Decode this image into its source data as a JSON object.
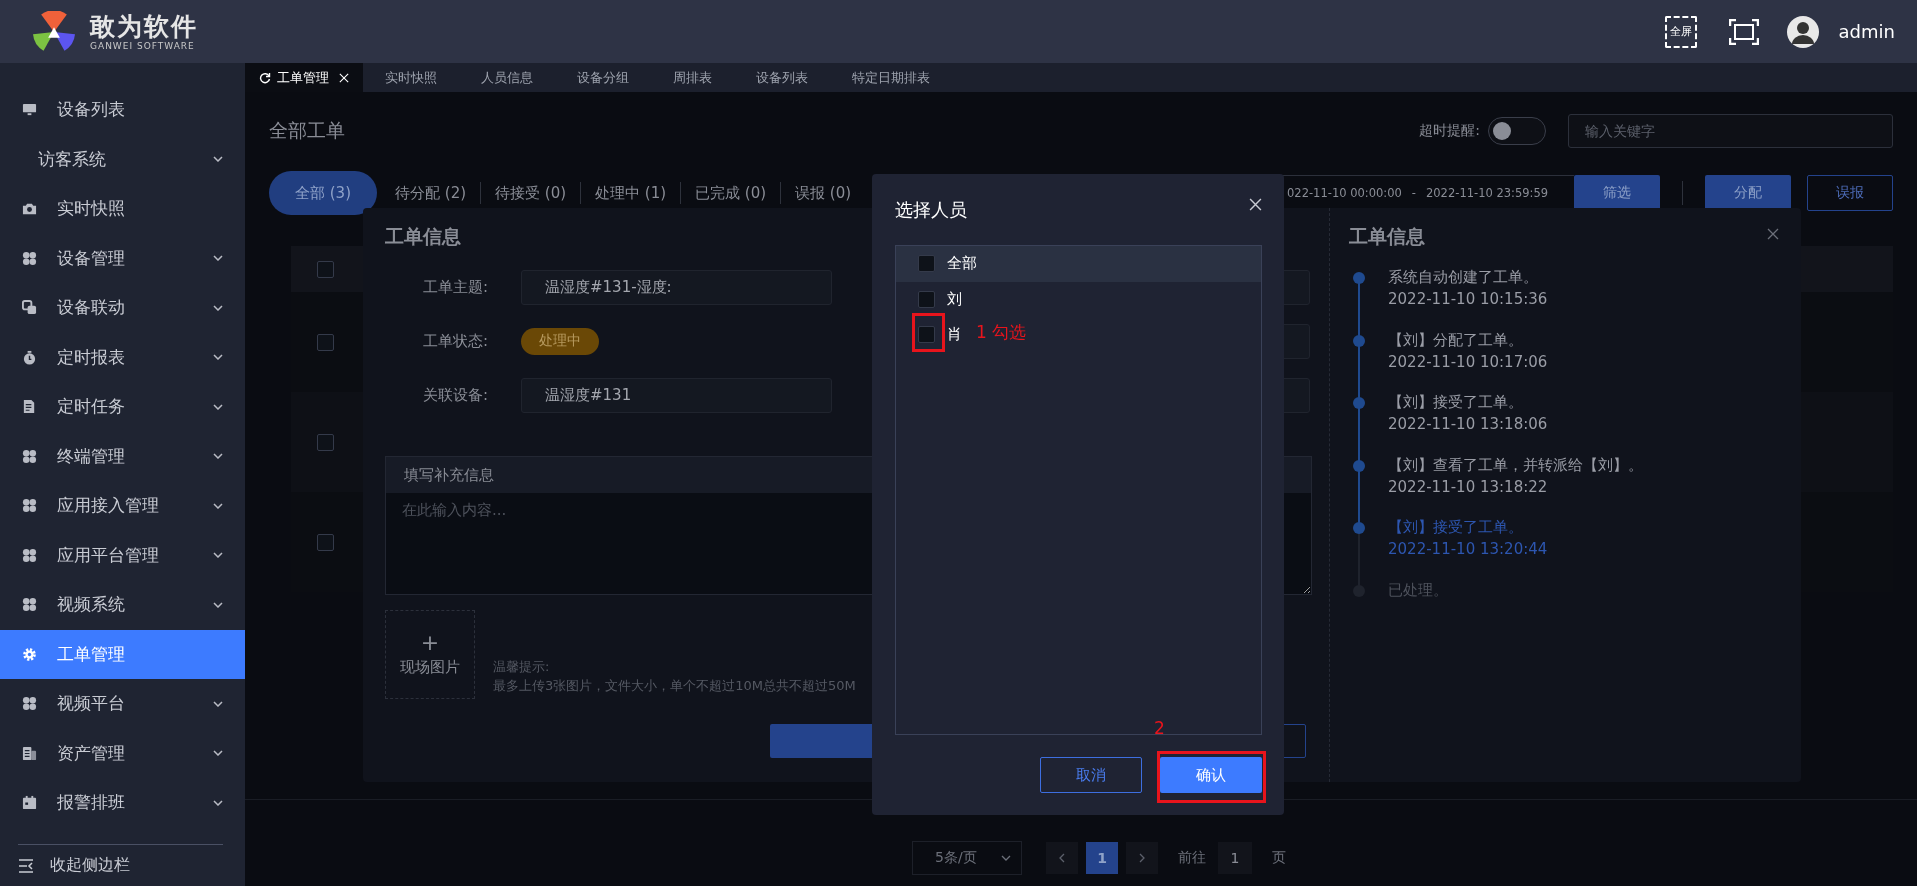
{
  "header": {
    "logo_title": "敢为软件",
    "logo_subtitle": "GANWEI SOFTWARE",
    "fullscreen_label": "全屏",
    "user": "admin"
  },
  "sidebar": {
    "items": [
      {
        "label": "设备列表",
        "kind": "monitor",
        "expandable": false,
        "selected": false
      },
      {
        "label": "访客系统",
        "kind": "plain",
        "expandable": true,
        "selected": false
      },
      {
        "label": "实时快照",
        "kind": "camera",
        "expandable": false,
        "selected": false
      },
      {
        "label": "设备管理",
        "kind": "clover",
        "expandable": true,
        "selected": false
      },
      {
        "label": "设备联动",
        "kind": "link",
        "expandable": true,
        "selected": false
      },
      {
        "label": "定时报表",
        "kind": "stopwatch",
        "expandable": true,
        "selected": false
      },
      {
        "label": "定时任务",
        "kind": "document",
        "expandable": true,
        "selected": false
      },
      {
        "label": "终端管理",
        "kind": "clover",
        "expandable": true,
        "selected": false
      },
      {
        "label": "应用接入管理",
        "kind": "clover",
        "expandable": true,
        "selected": false
      },
      {
        "label": "应用平台管理",
        "kind": "clover",
        "expandable": true,
        "selected": false
      },
      {
        "label": "视频系统",
        "kind": "clover",
        "expandable": true,
        "selected": false
      },
      {
        "label": "工单管理",
        "kind": "gear",
        "expandable": false,
        "selected": true
      },
      {
        "label": "视频平台",
        "kind": "clover",
        "expandable": true,
        "selected": false
      },
      {
        "label": "资产管理",
        "kind": "ledger",
        "expandable": true,
        "selected": false
      },
      {
        "label": "报警排班",
        "kind": "calendar",
        "expandable": true,
        "selected": false
      }
    ],
    "collapse_label": "收起侧边栏"
  },
  "tabs": [
    {
      "label": "工单管理",
      "selected": true,
      "closable": true
    },
    {
      "label": "实时快照",
      "selected": false,
      "closable": false
    },
    {
      "label": "人员信息",
      "selected": false,
      "closable": false
    },
    {
      "label": "设备分组",
      "selected": false,
      "closable": false
    },
    {
      "label": "周排表",
      "selected": false,
      "closable": false
    },
    {
      "label": "设备列表",
      "selected": false,
      "closable": false
    },
    {
      "label": "特定日期排表",
      "selected": false,
      "closable": false
    }
  ],
  "page": {
    "title": "全部工单",
    "timeout_label": "超时提醒:",
    "timeout_on": false,
    "search_placeholder": "输入关键字"
  },
  "filters": [
    {
      "label": "全部 (3)",
      "selected": true
    },
    {
      "label": "待分配 (2)",
      "selected": false
    },
    {
      "label": "待接受 (0)",
      "selected": false
    },
    {
      "label": "处理中 (1)",
      "selected": false
    },
    {
      "label": "已完成 (0)",
      "selected": false
    },
    {
      "label": "误报 (0)",
      "selected": false
    }
  ],
  "date_range": {
    "start": "022-11-10 00:00:00",
    "separator": "-",
    "end": "2022-11-10 23:59:59"
  },
  "actions": [
    {
      "label": "筛选",
      "kind": "primary"
    },
    {
      "label": "分配",
      "kind": "primary"
    },
    {
      "label": "误报",
      "kind": "outline"
    }
  ],
  "table": {
    "header_checked": false,
    "rows": [
      {
        "checked": false
      },
      {
        "checked": false
      },
      {
        "checked": false
      }
    ]
  },
  "pagination": {
    "page_size": "5条/页",
    "pages": [
      {
        "label": "1",
        "selected": true
      }
    ],
    "goto_label": "前往",
    "goto_value": "1",
    "page_label": "页"
  },
  "order_dialog": {
    "title": "工单信息",
    "fields": [
      {
        "label": "工单主题:",
        "kind": "input",
        "value": "温湿度#131-湿度:"
      },
      {
        "label": "工单状态:",
        "kind": "badge",
        "value": "处理中"
      },
      {
        "label": "关联设备:",
        "kind": "input",
        "value": "温湿度#131"
      }
    ],
    "note_title": "填写补充信息",
    "note_placeholder": "在此输入内容...",
    "upload_plus": "+",
    "upload_label": "现场图片",
    "hint_title": "温馨提示:",
    "hint": "最多上传3张图片，文件大小，单个不超过10M总共不超过50M"
  },
  "history": {
    "title": "工单信息",
    "events": [
      {
        "text": "系统自动创建了工单。",
        "time": "2022-11-10 10:15:36",
        "reached": true,
        "current": false
      },
      {
        "text": "【刘】分配了工单。",
        "time": "2022-11-10 10:17:06",
        "reached": true,
        "current": false
      },
      {
        "text": "【刘】接受了工单。",
        "time": "2022-11-10 13:18:06",
        "reached": true,
        "current": false
      },
      {
        "text": "【刘】查看了工单，并转派给【刘】。",
        "time": "2022-11-10 13:18:22",
        "reached": true,
        "current": false
      },
      {
        "text": "【刘】接受了工单。",
        "time": "2022-11-10 13:20:44",
        "reached": true,
        "current": true
      },
      {
        "text": "已处理。",
        "reached": false,
        "current": false
      }
    ]
  },
  "select_dialog": {
    "title": "选择人员",
    "options": [
      {
        "label": "全部",
        "kind": "all",
        "checked": false
      },
      {
        "label": "刘",
        "kind": "person",
        "checked": false
      },
      {
        "label": "肖",
        "kind": "person",
        "checked": false
      }
    ],
    "buttons": [
      {
        "label": "取消",
        "kind": "outline"
      },
      {
        "label": "确认",
        "kind": "primary"
      }
    ]
  },
  "annotations": [
    {
      "text": "1 勾选"
    },
    {
      "text": "2"
    }
  ]
}
